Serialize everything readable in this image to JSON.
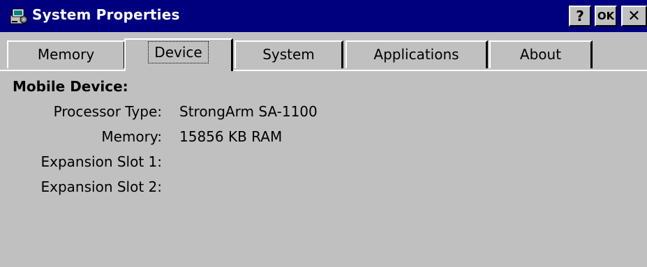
{
  "window": {
    "title": "System Properties",
    "help_label": "?",
    "ok_label": "OK",
    "close_label": "✕",
    "icon": "system-properties-icon"
  },
  "tabs": [
    {
      "label": "Memory",
      "selected": false
    },
    {
      "label": "Device",
      "selected": true
    },
    {
      "label": "System",
      "selected": false
    },
    {
      "label": "Applications",
      "selected": false
    },
    {
      "label": "About",
      "selected": false
    }
  ],
  "device": {
    "heading": "Mobile Device:",
    "fields": [
      {
        "label": "Processor Type:",
        "value": "StrongArm SA-1100"
      },
      {
        "label": "Memory:",
        "value": "15856 KB RAM"
      },
      {
        "label": "Expansion Slot 1:",
        "value": ""
      },
      {
        "label": "Expansion Slot 2:",
        "value": ""
      }
    ]
  },
  "colors": {
    "titlebar": "#00007f",
    "face": "#c0c0c0",
    "title_text": "#ffffff"
  }
}
